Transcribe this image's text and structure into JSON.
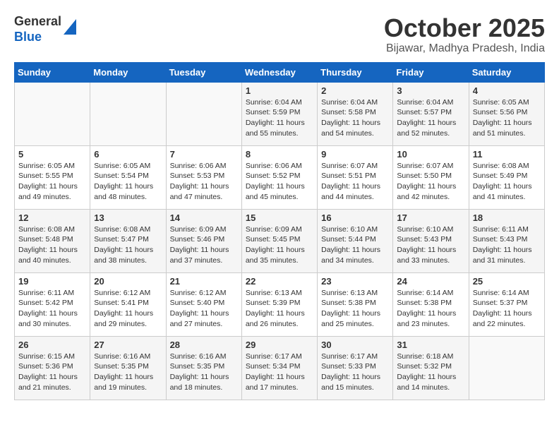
{
  "header": {
    "logo_line1": "General",
    "logo_line2": "Blue",
    "month": "October 2025",
    "location": "Bijawar, Madhya Pradesh, India"
  },
  "weekdays": [
    "Sunday",
    "Monday",
    "Tuesday",
    "Wednesday",
    "Thursday",
    "Friday",
    "Saturday"
  ],
  "weeks": [
    [
      {
        "day": "",
        "info": ""
      },
      {
        "day": "",
        "info": ""
      },
      {
        "day": "",
        "info": ""
      },
      {
        "day": "1",
        "info": "Sunrise: 6:04 AM\nSunset: 5:59 PM\nDaylight: 11 hours\nand 55 minutes."
      },
      {
        "day": "2",
        "info": "Sunrise: 6:04 AM\nSunset: 5:58 PM\nDaylight: 11 hours\nand 54 minutes."
      },
      {
        "day": "3",
        "info": "Sunrise: 6:04 AM\nSunset: 5:57 PM\nDaylight: 11 hours\nand 52 minutes."
      },
      {
        "day": "4",
        "info": "Sunrise: 6:05 AM\nSunset: 5:56 PM\nDaylight: 11 hours\nand 51 minutes."
      }
    ],
    [
      {
        "day": "5",
        "info": "Sunrise: 6:05 AM\nSunset: 5:55 PM\nDaylight: 11 hours\nand 49 minutes."
      },
      {
        "day": "6",
        "info": "Sunrise: 6:05 AM\nSunset: 5:54 PM\nDaylight: 11 hours\nand 48 minutes."
      },
      {
        "day": "7",
        "info": "Sunrise: 6:06 AM\nSunset: 5:53 PM\nDaylight: 11 hours\nand 47 minutes."
      },
      {
        "day": "8",
        "info": "Sunrise: 6:06 AM\nSunset: 5:52 PM\nDaylight: 11 hours\nand 45 minutes."
      },
      {
        "day": "9",
        "info": "Sunrise: 6:07 AM\nSunset: 5:51 PM\nDaylight: 11 hours\nand 44 minutes."
      },
      {
        "day": "10",
        "info": "Sunrise: 6:07 AM\nSunset: 5:50 PM\nDaylight: 11 hours\nand 42 minutes."
      },
      {
        "day": "11",
        "info": "Sunrise: 6:08 AM\nSunset: 5:49 PM\nDaylight: 11 hours\nand 41 minutes."
      }
    ],
    [
      {
        "day": "12",
        "info": "Sunrise: 6:08 AM\nSunset: 5:48 PM\nDaylight: 11 hours\nand 40 minutes."
      },
      {
        "day": "13",
        "info": "Sunrise: 6:08 AM\nSunset: 5:47 PM\nDaylight: 11 hours\nand 38 minutes."
      },
      {
        "day": "14",
        "info": "Sunrise: 6:09 AM\nSunset: 5:46 PM\nDaylight: 11 hours\nand 37 minutes."
      },
      {
        "day": "15",
        "info": "Sunrise: 6:09 AM\nSunset: 5:45 PM\nDaylight: 11 hours\nand 35 minutes."
      },
      {
        "day": "16",
        "info": "Sunrise: 6:10 AM\nSunset: 5:44 PM\nDaylight: 11 hours\nand 34 minutes."
      },
      {
        "day": "17",
        "info": "Sunrise: 6:10 AM\nSunset: 5:43 PM\nDaylight: 11 hours\nand 33 minutes."
      },
      {
        "day": "18",
        "info": "Sunrise: 6:11 AM\nSunset: 5:43 PM\nDaylight: 11 hours\nand 31 minutes."
      }
    ],
    [
      {
        "day": "19",
        "info": "Sunrise: 6:11 AM\nSunset: 5:42 PM\nDaylight: 11 hours\nand 30 minutes."
      },
      {
        "day": "20",
        "info": "Sunrise: 6:12 AM\nSunset: 5:41 PM\nDaylight: 11 hours\nand 29 minutes."
      },
      {
        "day": "21",
        "info": "Sunrise: 6:12 AM\nSunset: 5:40 PM\nDaylight: 11 hours\nand 27 minutes."
      },
      {
        "day": "22",
        "info": "Sunrise: 6:13 AM\nSunset: 5:39 PM\nDaylight: 11 hours\nand 26 minutes."
      },
      {
        "day": "23",
        "info": "Sunrise: 6:13 AM\nSunset: 5:38 PM\nDaylight: 11 hours\nand 25 minutes."
      },
      {
        "day": "24",
        "info": "Sunrise: 6:14 AM\nSunset: 5:38 PM\nDaylight: 11 hours\nand 23 minutes."
      },
      {
        "day": "25",
        "info": "Sunrise: 6:14 AM\nSunset: 5:37 PM\nDaylight: 11 hours\nand 22 minutes."
      }
    ],
    [
      {
        "day": "26",
        "info": "Sunrise: 6:15 AM\nSunset: 5:36 PM\nDaylight: 11 hours\nand 21 minutes."
      },
      {
        "day": "27",
        "info": "Sunrise: 6:16 AM\nSunset: 5:35 PM\nDaylight: 11 hours\nand 19 minutes."
      },
      {
        "day": "28",
        "info": "Sunrise: 6:16 AM\nSunset: 5:35 PM\nDaylight: 11 hours\nand 18 minutes."
      },
      {
        "day": "29",
        "info": "Sunrise: 6:17 AM\nSunset: 5:34 PM\nDaylight: 11 hours\nand 17 minutes."
      },
      {
        "day": "30",
        "info": "Sunrise: 6:17 AM\nSunset: 5:33 PM\nDaylight: 11 hours\nand 15 minutes."
      },
      {
        "day": "31",
        "info": "Sunrise: 6:18 AM\nSunset: 5:32 PM\nDaylight: 11 hours\nand 14 minutes."
      },
      {
        "day": "",
        "info": ""
      }
    ]
  ]
}
